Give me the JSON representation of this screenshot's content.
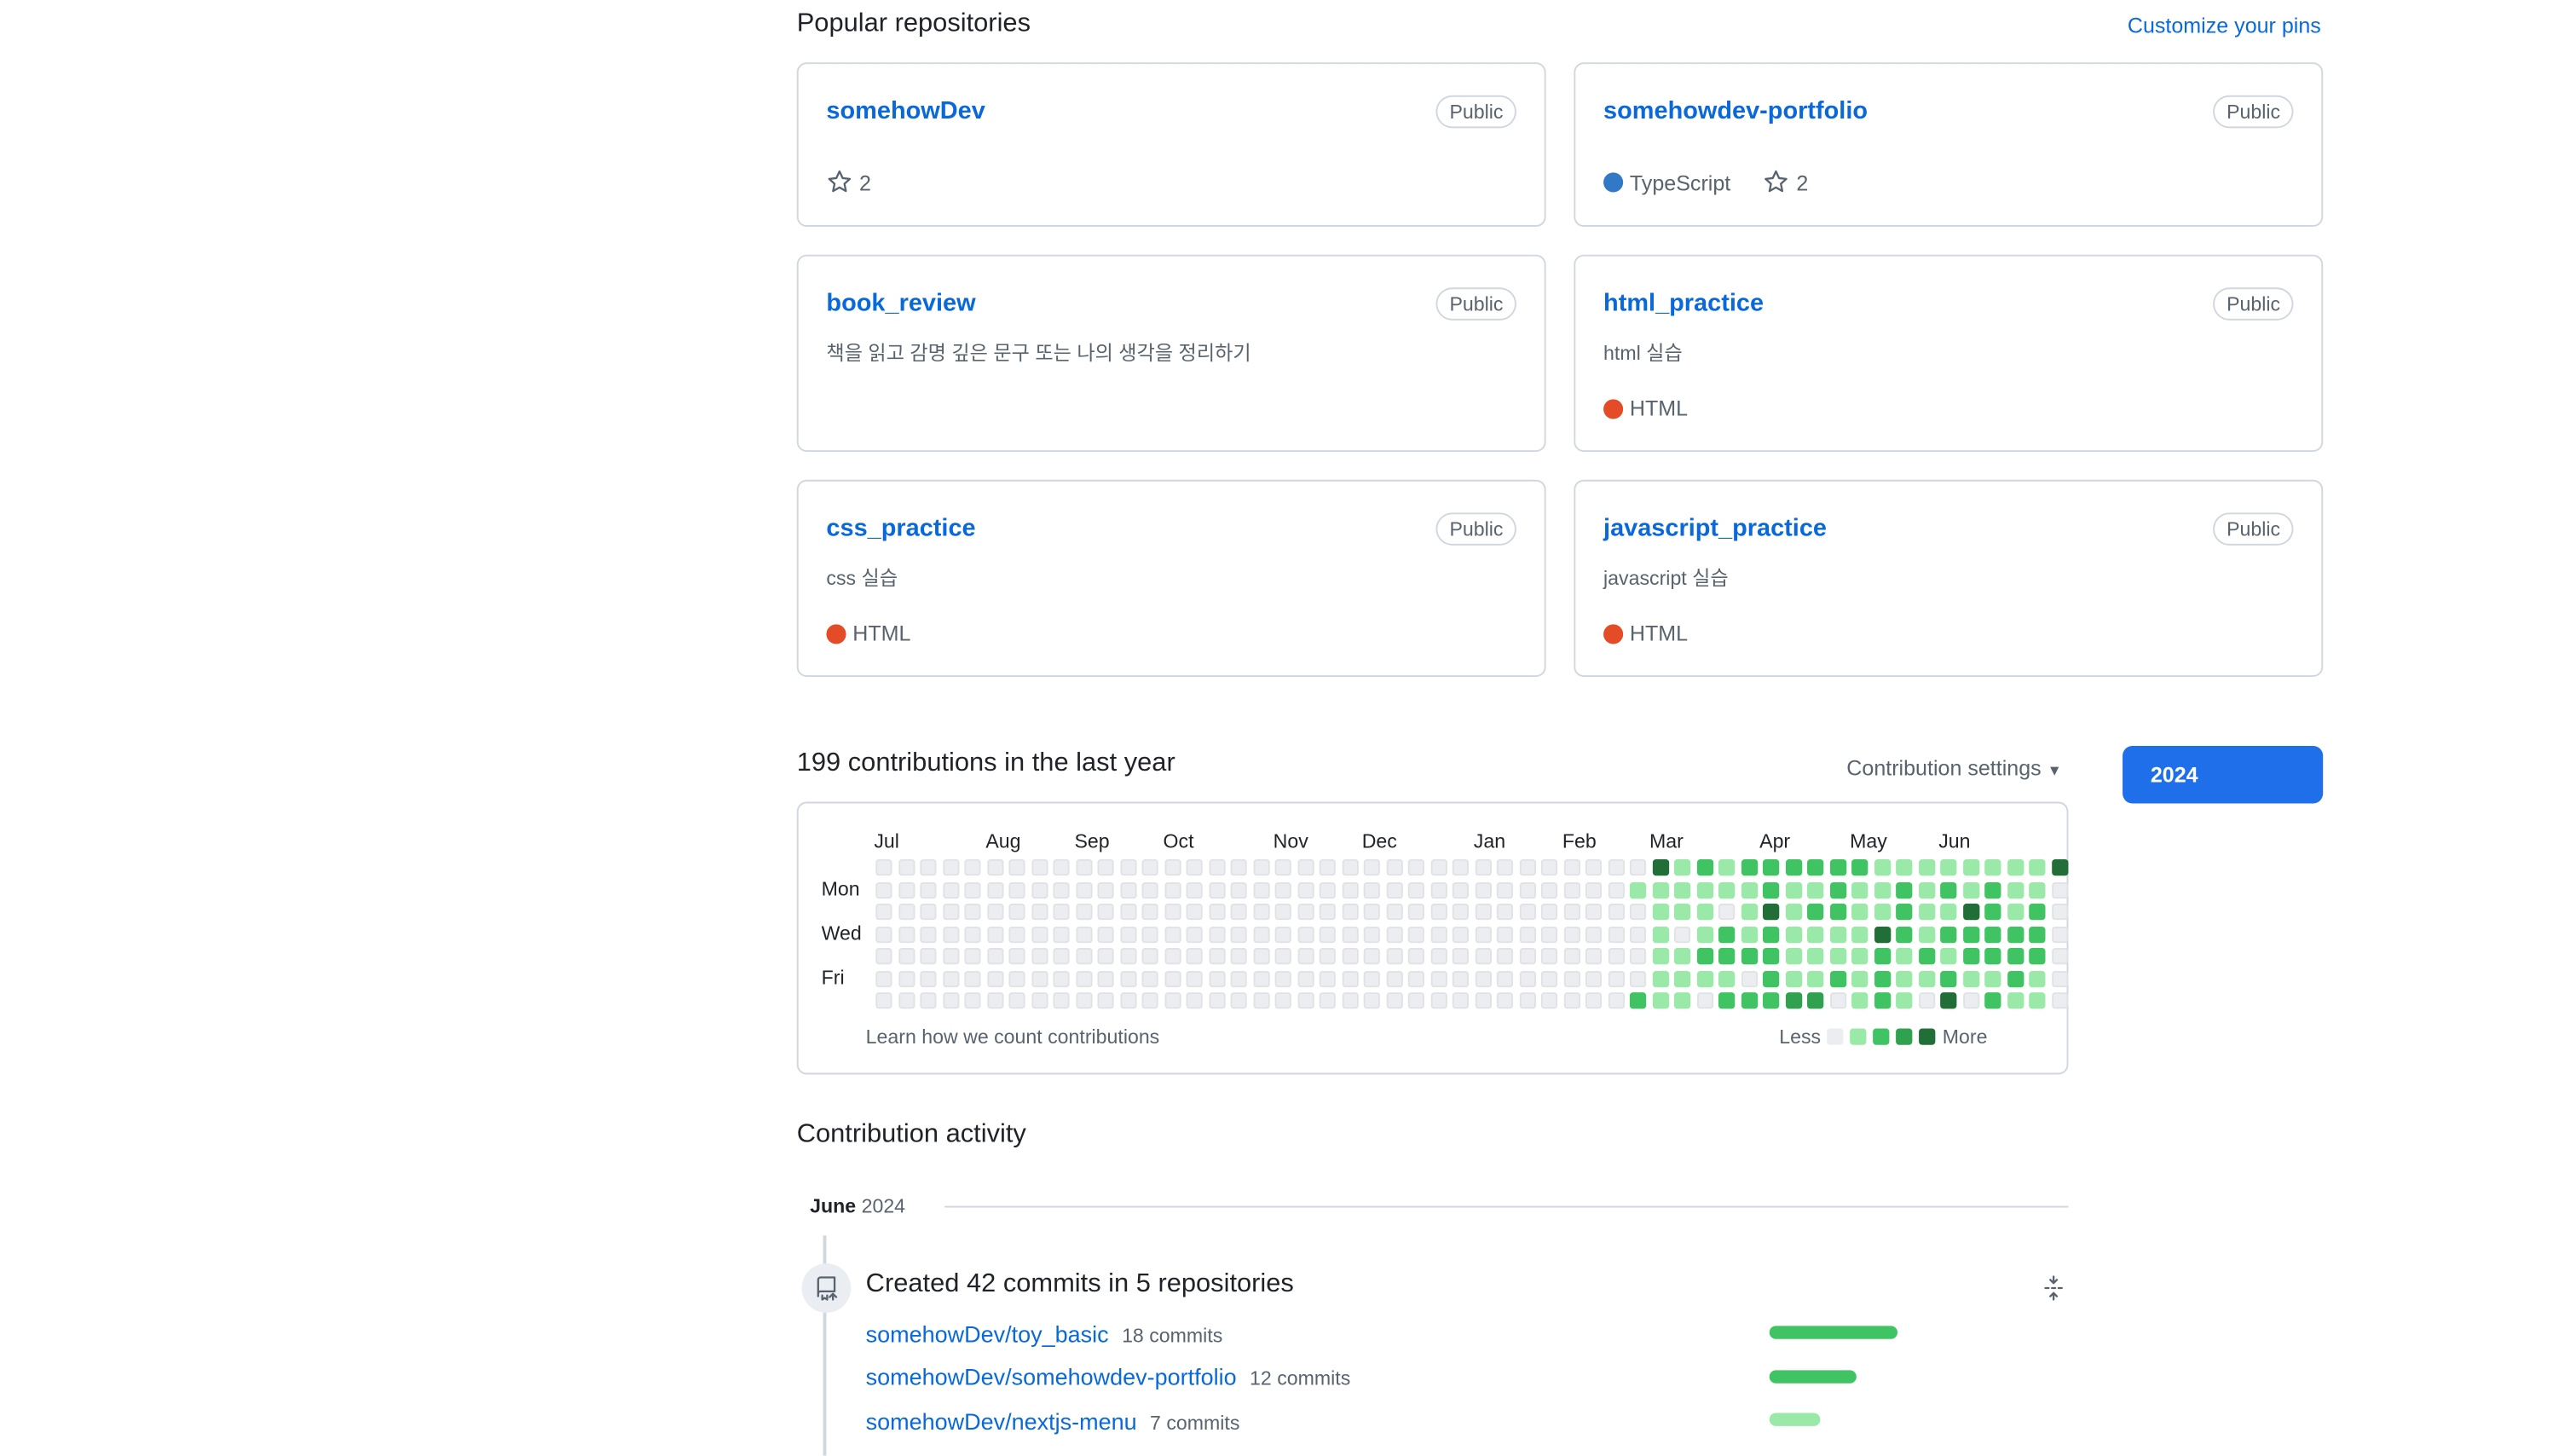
{
  "pinned": {
    "title": "Popular repositories",
    "customize_label": "Customize your pins",
    "cards": [
      {
        "name": "somehowDev",
        "visibility": "Public",
        "description": "",
        "language": "",
        "language_color": "",
        "stars": "2"
      },
      {
        "name": "somehowdev-portfolio",
        "visibility": "Public",
        "description": "",
        "language": "TypeScript",
        "language_color": "#3178c6",
        "stars": "2"
      },
      {
        "name": "book_review",
        "visibility": "Public",
        "description": "책을 읽고 감명 깊은 문구 또는 나의 생각을 정리하기",
        "language": "",
        "language_color": "",
        "stars": ""
      },
      {
        "name": "html_practice",
        "visibility": "Public",
        "description": "html 실습",
        "language": "HTML",
        "language_color": "#e34c26",
        "stars": ""
      },
      {
        "name": "css_practice",
        "visibility": "Public",
        "description": "css 실습",
        "language": "HTML",
        "language_color": "#e34c26",
        "stars": ""
      },
      {
        "name": "javascript_practice",
        "visibility": "Public",
        "description": "javascript 실습",
        "language": "HTML",
        "language_color": "#e34c26",
        "stars": ""
      }
    ]
  },
  "contributions": {
    "title": "199 contributions in the last year",
    "settings_label": "Contribution settings",
    "year_button": "2024",
    "months": [
      "Jul",
      "Aug",
      "Sep",
      "Oct",
      "Nov",
      "Dec",
      "Jan",
      "Feb",
      "Mar",
      "Apr",
      "May",
      "Jun"
    ],
    "days": [
      "Mon",
      "Wed",
      "Fri"
    ],
    "learn_label": "Learn how we count contributions",
    "legend_less": "Less",
    "legend_more": "More",
    "level_colors": [
      "#ebedf0",
      "#9be9a8",
      "#40c463",
      "#30a14e",
      "#216e39"
    ],
    "weeks_levels": [
      [
        0,
        0,
        0,
        0,
        0,
        0,
        0
      ],
      [
        0,
        0,
        0,
        0,
        0,
        0,
        0
      ],
      [
        0,
        0,
        0,
        0,
        0,
        0,
        0
      ],
      [
        0,
        0,
        0,
        0,
        0,
        0,
        0
      ],
      [
        0,
        0,
        0,
        0,
        0,
        0,
        0
      ],
      [
        0,
        0,
        0,
        0,
        0,
        0,
        0
      ],
      [
        0,
        0,
        0,
        0,
        0,
        0,
        0
      ],
      [
        0,
        0,
        0,
        0,
        0,
        0,
        0
      ],
      [
        0,
        0,
        0,
        0,
        0,
        0,
        0
      ],
      [
        0,
        0,
        0,
        0,
        0,
        0,
        0
      ],
      [
        0,
        0,
        0,
        0,
        0,
        0,
        0
      ],
      [
        0,
        0,
        0,
        0,
        0,
        0,
        0
      ],
      [
        0,
        0,
        0,
        0,
        0,
        0,
        0
      ],
      [
        0,
        0,
        0,
        0,
        0,
        0,
        0
      ],
      [
        0,
        0,
        0,
        0,
        0,
        0,
        0
      ],
      [
        0,
        0,
        0,
        0,
        0,
        0,
        0
      ],
      [
        0,
        0,
        0,
        0,
        0,
        0,
        0
      ],
      [
        0,
        0,
        0,
        0,
        0,
        0,
        0
      ],
      [
        0,
        0,
        0,
        0,
        0,
        0,
        0
      ],
      [
        0,
        0,
        0,
        0,
        0,
        0,
        0
      ],
      [
        0,
        0,
        0,
        0,
        0,
        0,
        0
      ],
      [
        0,
        0,
        0,
        0,
        0,
        0,
        0
      ],
      [
        0,
        0,
        0,
        0,
        0,
        0,
        0
      ],
      [
        0,
        0,
        0,
        0,
        0,
        0,
        0
      ],
      [
        0,
        0,
        0,
        0,
        0,
        0,
        0
      ],
      [
        0,
        0,
        0,
        0,
        0,
        0,
        0
      ],
      [
        0,
        0,
        0,
        0,
        0,
        0,
        0
      ],
      [
        0,
        0,
        0,
        0,
        0,
        0,
        0
      ],
      [
        0,
        0,
        0,
        0,
        0,
        0,
        0
      ],
      [
        0,
        0,
        0,
        0,
        0,
        0,
        0
      ],
      [
        0,
        0,
        0,
        0,
        0,
        0,
        0
      ],
      [
        0,
        0,
        0,
        0,
        0,
        0,
        0
      ],
      [
        0,
        0,
        0,
        0,
        0,
        0,
        0
      ],
      [
        0,
        0,
        0,
        0,
        0,
        0,
        0
      ],
      [
        0,
        1,
        0,
        0,
        0,
        0,
        2
      ],
      [
        4,
        1,
        1,
        1,
        1,
        1,
        1
      ],
      [
        1,
        1,
        1,
        0,
        1,
        1,
        1
      ],
      [
        2,
        1,
        1,
        1,
        2,
        1,
        0
      ],
      [
        1,
        1,
        0,
        2,
        2,
        1,
        2
      ],
      [
        2,
        1,
        1,
        1,
        2,
        0,
        2
      ],
      [
        2,
        2,
        4,
        2,
        2,
        2,
        2
      ],
      [
        2,
        1,
        1,
        1,
        1,
        1,
        3
      ],
      [
        2,
        1,
        2,
        1,
        1,
        1,
        3
      ],
      [
        2,
        2,
        2,
        1,
        1,
        2,
        0
      ],
      [
        2,
        1,
        1,
        1,
        1,
        1,
        1
      ],
      [
        1,
        1,
        1,
        4,
        2,
        2,
        2
      ],
      [
        1,
        2,
        2,
        2,
        1,
        1,
        1
      ],
      [
        1,
        1,
        1,
        1,
        2,
        1,
        0
      ],
      [
        1,
        2,
        1,
        2,
        1,
        2,
        4
      ],
      [
        1,
        1,
        4,
        2,
        2,
        1,
        0
      ],
      [
        1,
        2,
        2,
        2,
        2,
        1,
        2
      ],
      [
        1,
        1,
        1,
        2,
        2,
        2,
        1
      ],
      [
        1,
        1,
        2,
        2,
        2,
        1,
        1
      ],
      [
        4,
        0,
        0,
        0,
        0,
        0,
        0
      ]
    ]
  },
  "activity": {
    "title": "Contribution activity",
    "month": "June",
    "year": "2024",
    "heading": "Created 42 commits in 5 repositories",
    "repos": [
      {
        "name": "somehowDev/toy_basic",
        "commits": "18 commits",
        "share": 0.43,
        "color": "#40c463"
      },
      {
        "name": "somehowDev/somehowdev-portfolio",
        "commits": "12 commits",
        "share": 0.29,
        "color": "#40c463"
      },
      {
        "name": "somehowDev/nextjs-menu",
        "commits": "7 commits",
        "share": 0.17,
        "color": "#9be9a8"
      }
    ]
  }
}
